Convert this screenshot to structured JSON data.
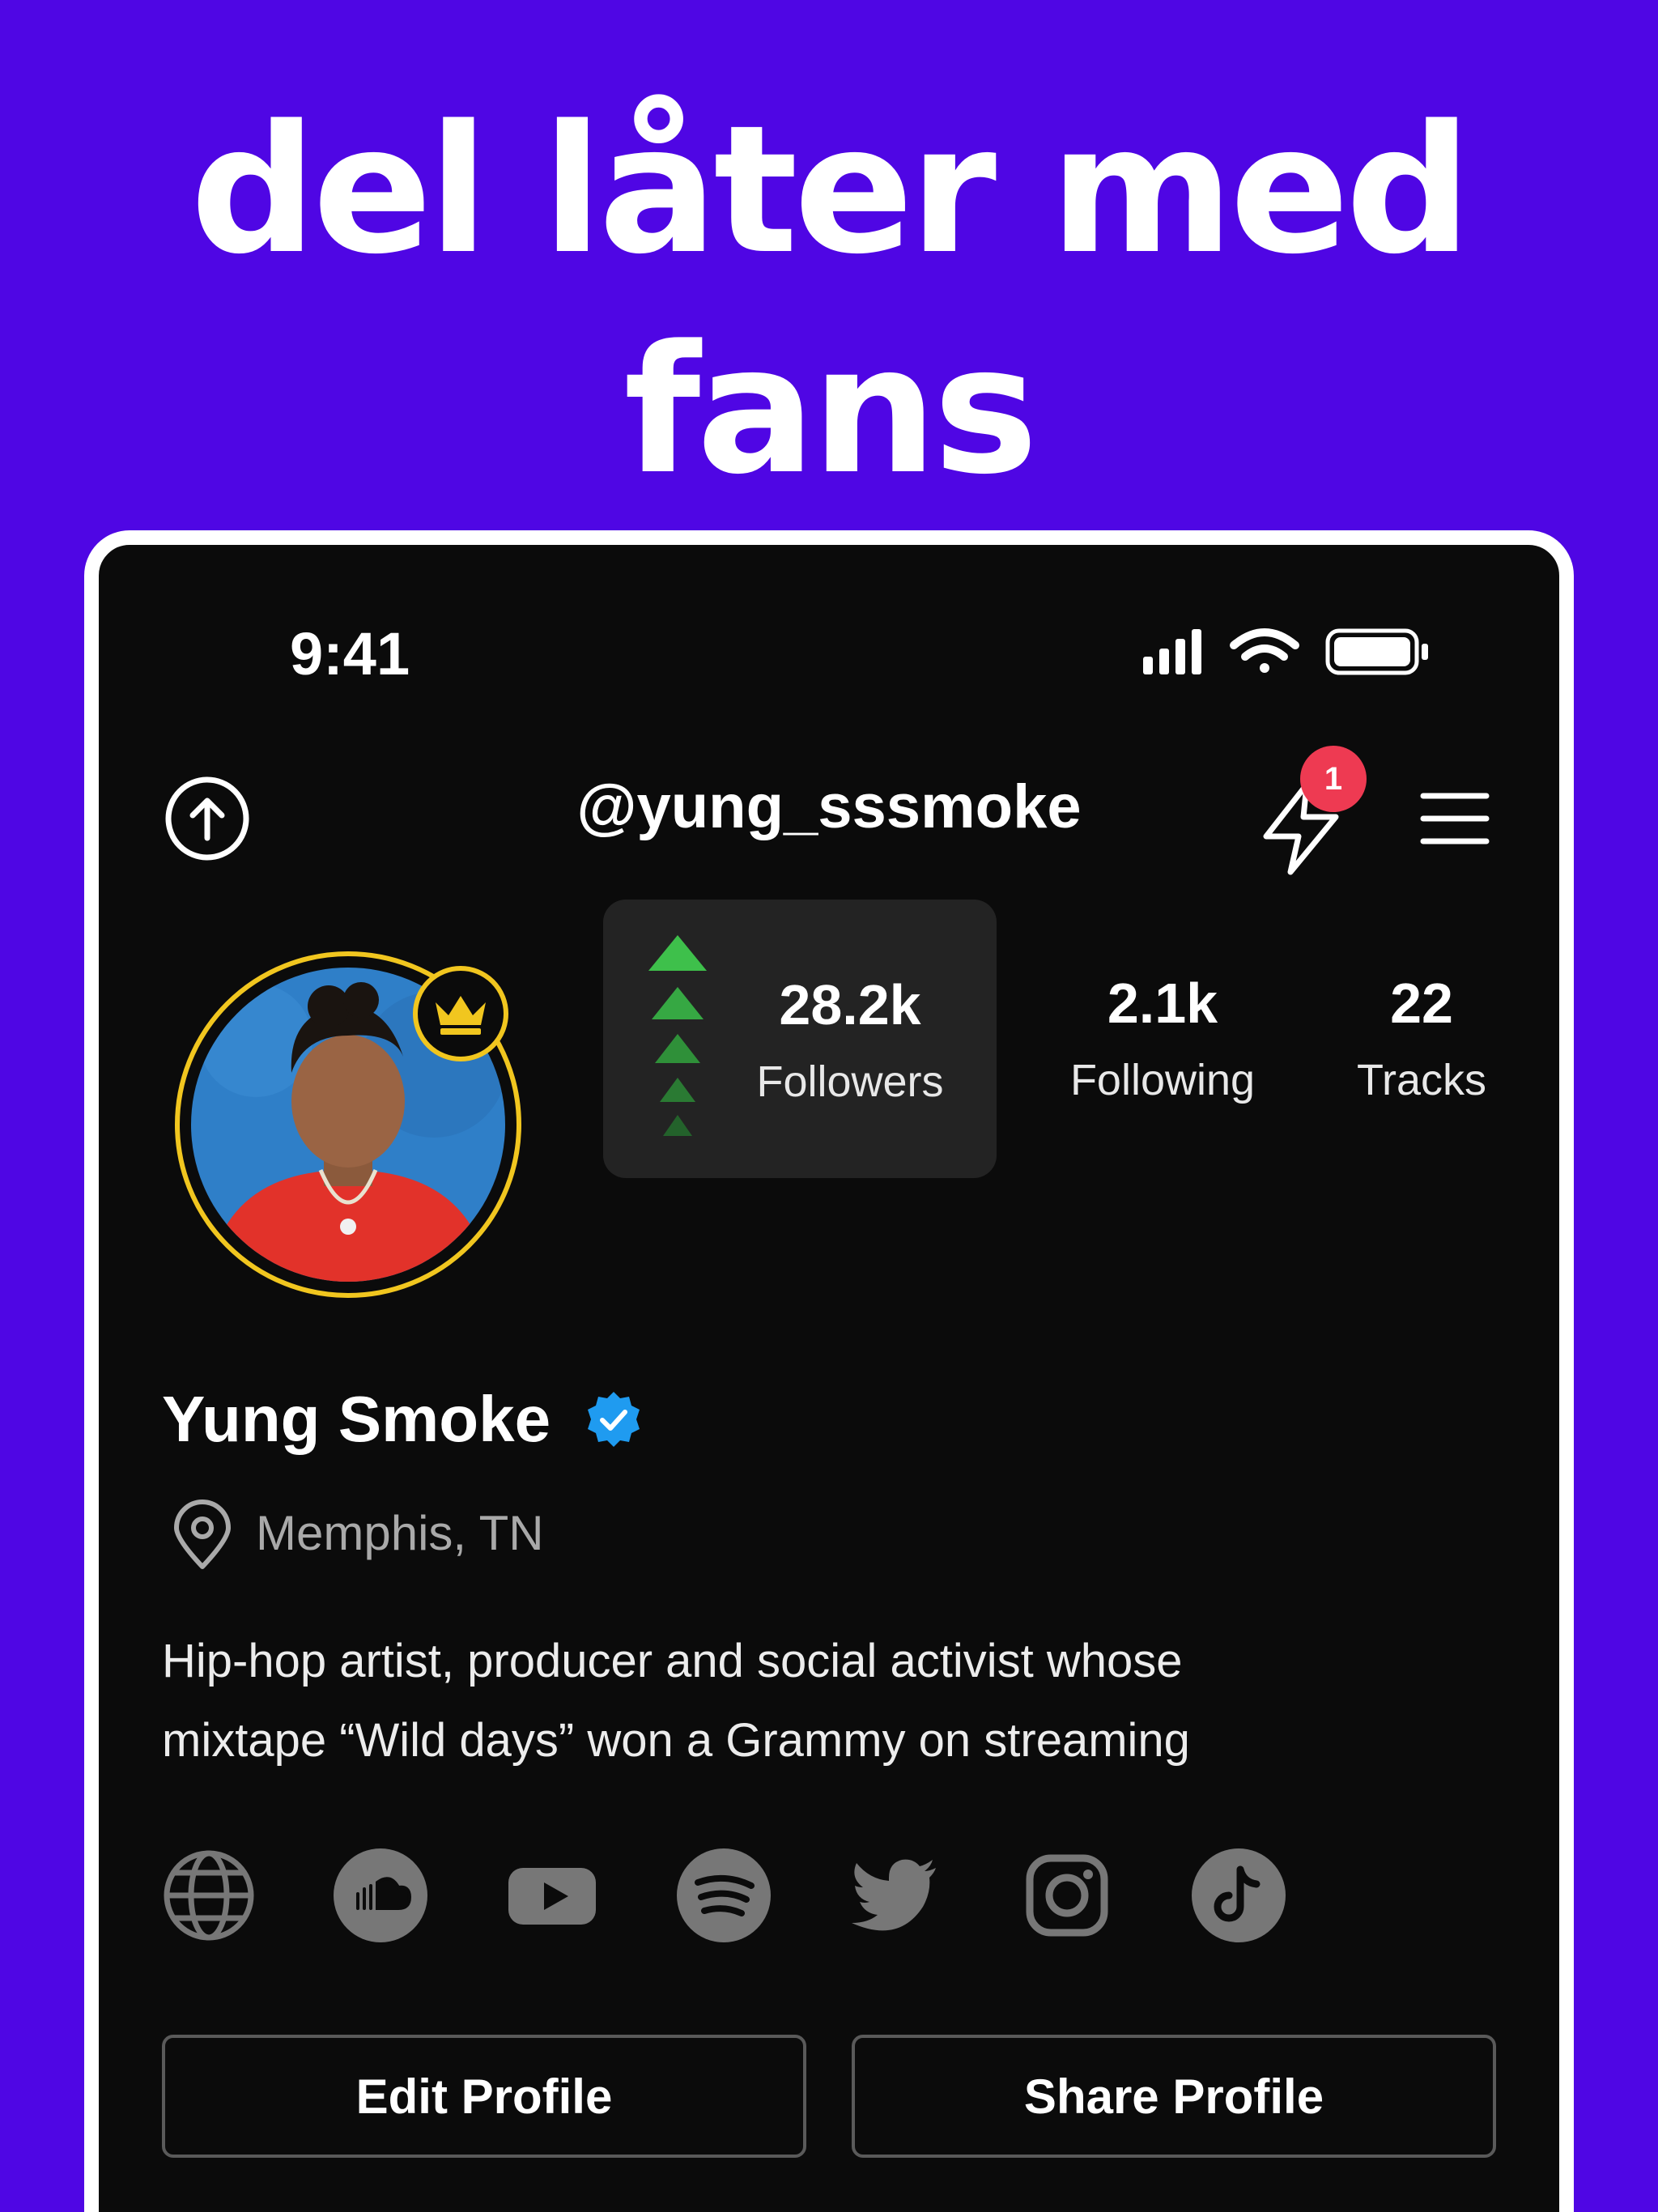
{
  "headline": {
    "line1": "del låter med",
    "line2": "fans"
  },
  "status_bar": {
    "time": "9:41"
  },
  "header": {
    "handle": "@yung_sssmoke",
    "notification_count": "1"
  },
  "stats": {
    "followers": {
      "value": "28.2k",
      "label": "Followers"
    },
    "following": {
      "value": "2.1k",
      "label": "Following"
    },
    "tracks": {
      "value": "22",
      "label": "Tracks"
    }
  },
  "profile": {
    "name": "Yung Smoke",
    "location": "Memphis, TN",
    "bio_line1": "Hip-hop artist, producer and social activist whose",
    "bio_line2": "mixtape “Wild days” won a Grammy on streaming"
  },
  "socials": [
    "globe-icon",
    "soundcloud-icon",
    "youtube-icon",
    "spotify-icon",
    "twitter-icon",
    "instagram-icon",
    "tiktok-icon"
  ],
  "actions": {
    "edit_label": "Edit Profile",
    "share_label": "Share Profile"
  },
  "colors": {
    "background": "#4f06e4",
    "accent_gold": "#f1c61f",
    "badge_red": "#ee3a52",
    "verified_blue": "#1f9bf0",
    "trend_green": "#3ec04b"
  }
}
